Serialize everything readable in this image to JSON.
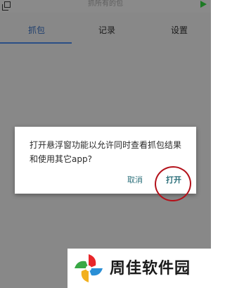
{
  "window": {
    "title": "抓所有的包"
  },
  "tabs": [
    {
      "label": "抓包",
      "active": true
    },
    {
      "label": "记录",
      "active": false
    },
    {
      "label": "设置",
      "active": false
    }
  ],
  "dialog": {
    "message": "打开悬浮窗功能以允许同时查看抓包结果和使用其它app?",
    "cancel_label": "取消",
    "confirm_label": "打开"
  },
  "watermark": {
    "text": "周佳软件园"
  },
  "colors": {
    "accent": "#2b6f7a",
    "tab_indicator": "#2a4f86",
    "annotation": "#b3111a",
    "play": "#1d7a24",
    "overlay": "#888888"
  },
  "icons": {
    "top_left": "copy-icon",
    "top_right": "play-icon",
    "watermark": "pinwheel-logo-icon"
  }
}
